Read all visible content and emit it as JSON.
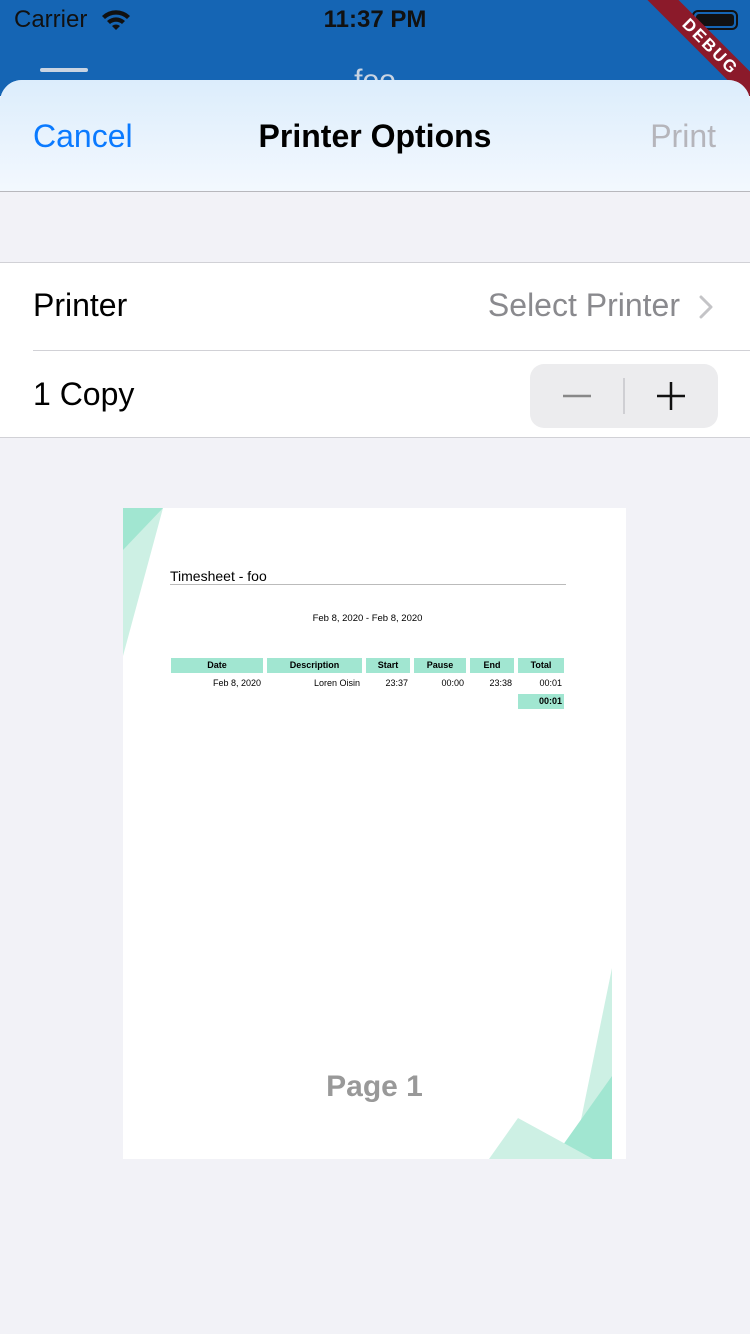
{
  "status_bar": {
    "carrier": "Carrier",
    "time": "11:37 PM",
    "debug_label": "DEBUG",
    "color": "#1565b4"
  },
  "background_app": {
    "title": "foo"
  },
  "sheet": {
    "nav": {
      "cancel_label": "Cancel",
      "title": "Printer Options",
      "print_label": "Print"
    },
    "printer_row": {
      "label": "Printer",
      "value": "Select Printer"
    },
    "copies_row": {
      "label": "1 Copy",
      "minus_icon": "minus-icon",
      "plus_icon": "plus-icon"
    },
    "accent_color": "#0a7aff"
  },
  "preview": {
    "document_title": "Timesheet - foo",
    "date_range": "Feb 8, 2020 - Feb 8, 2020",
    "table": {
      "headers": [
        "Date",
        "Description",
        "Start",
        "Pause",
        "End",
        "Total"
      ],
      "rows": [
        [
          "Feb 8, 2020",
          "Loren Oisin",
          "23:37",
          "00:00",
          "23:38",
          "00:01"
        ]
      ],
      "grand_total": "00:01"
    },
    "page_label": "Page 1",
    "theme_color": "#a1e6d1"
  }
}
